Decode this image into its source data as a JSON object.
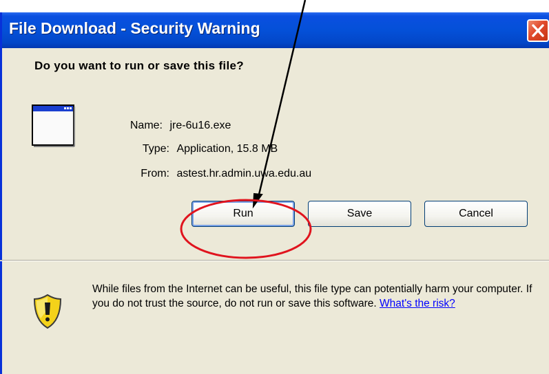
{
  "window": {
    "title": "File Download - Security Warning",
    "close_label": "Close"
  },
  "dialog": {
    "question": "Do you want to run or save this file?",
    "file": {
      "name_label": "Name:",
      "name_value": "jre-6u16.exe",
      "type_label": "Type:",
      "type_value": "Application, 15.8 MB",
      "from_label": "From:",
      "from_value": "astest.hr.admin.uwa.edu.au"
    },
    "buttons": {
      "run": "Run",
      "save": "Save",
      "cancel": "Cancel"
    },
    "warning": {
      "text": "While files from the Internet can be useful, this file type can potentially harm your computer. If you do not trust the source, do not run or save this software. ",
      "link": "What's the risk?"
    }
  },
  "annotation": {
    "color": "#e0141e",
    "icons": [
      "arrow-pointer",
      "highlight-ellipse"
    ]
  },
  "icons": {
    "app": "application-window-icon",
    "shield": "security-shield-icon",
    "close": "close-x-icon"
  }
}
